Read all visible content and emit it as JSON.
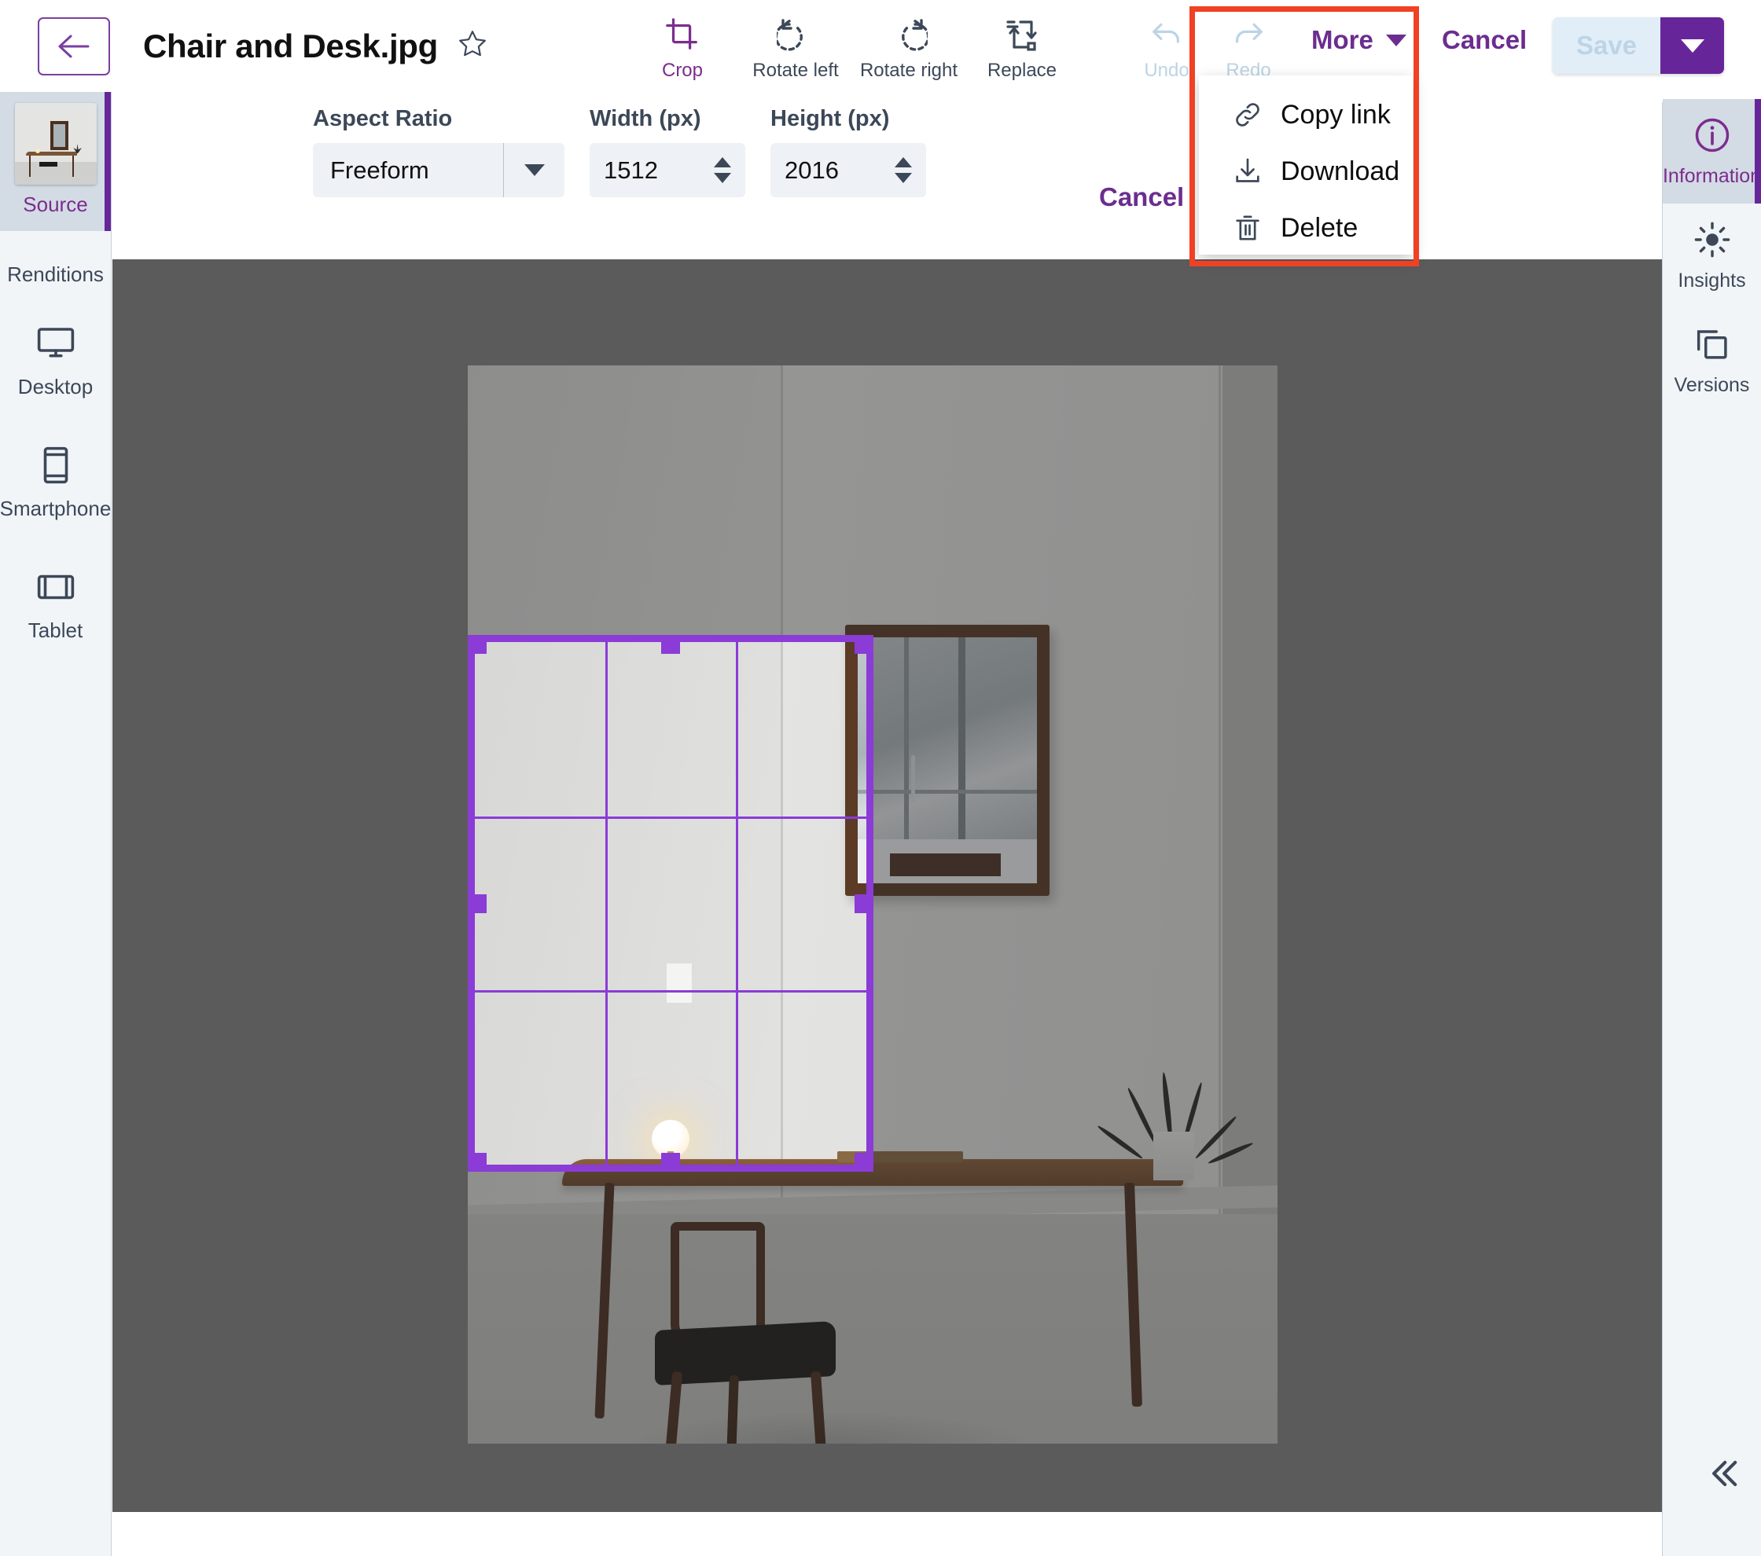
{
  "header": {
    "back_icon": "arrow-left-icon",
    "file_name": "Chair and Desk.jpg",
    "favorite_icon": "star-outline-icon",
    "tools": [
      {
        "label": "Crop",
        "icon": "crop-icon",
        "active": true
      },
      {
        "label": "Rotate left",
        "icon": "rotate-left-icon",
        "active": false
      },
      {
        "label": "Rotate right",
        "icon": "rotate-right-icon",
        "active": false
      },
      {
        "label": "Replace",
        "icon": "replace-icon",
        "active": false
      }
    ],
    "history": [
      {
        "label": "Undo",
        "icon": "undo-icon",
        "disabled": true
      },
      {
        "label": "Redo",
        "icon": "redo-icon",
        "disabled": true
      }
    ],
    "more_label": "More",
    "more_caret_icon": "caret-down-icon",
    "cancel_label": "Cancel",
    "save_label": "Save",
    "save_caret_icon": "caret-down-white-icon"
  },
  "more_menu": {
    "items": [
      {
        "label": "Copy link",
        "icon": "link-icon"
      },
      {
        "label": "Download",
        "icon": "download-icon"
      },
      {
        "label": "Delete",
        "icon": "trash-icon"
      }
    ],
    "highlight_color": "#f04124"
  },
  "crop_bar": {
    "aspect_ratio_label": "Aspect Ratio",
    "aspect_ratio_value": "Freeform",
    "aspect_ratio_caret_icon": "caret-down-icon",
    "width_label": "Width (px)",
    "width_value": "1512",
    "height_label": "Height (px)",
    "height_value": "2016",
    "cancel_label": "Cancel"
  },
  "left_rail": {
    "source": {
      "label": "Source",
      "icon": "image-thumbnail",
      "selected": true
    },
    "renditions_label": "Renditions",
    "items": [
      {
        "label": "Desktop",
        "icon": "monitor-icon"
      },
      {
        "label": "Smartphone",
        "icon": "smartphone-icon"
      },
      {
        "label": "Tablet",
        "icon": "tablet-icon"
      }
    ]
  },
  "right_rail": {
    "items": [
      {
        "label": "Information",
        "icon": "info-circle-icon",
        "selected": true
      },
      {
        "label": "Insights",
        "icon": "sun-icon",
        "selected": false
      },
      {
        "label": "Versions",
        "icon": "copy-layers-icon",
        "selected": false
      }
    ],
    "collapse_icon": "chevron-double-left-icon"
  },
  "colors": {
    "accent_purple": "#6b2d8f",
    "crop_purple": "#8b3bd6",
    "canvas_gray": "#808080",
    "rail_bg": "#f2f5f8",
    "highlight_red": "#f04124",
    "disabled_blue": "#bcd4e6"
  }
}
